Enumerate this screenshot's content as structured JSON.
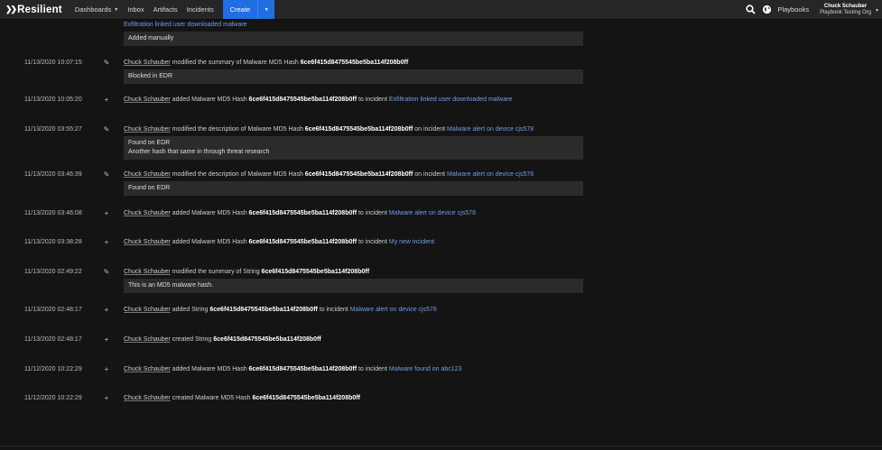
{
  "nav": {
    "logo": "Resilient",
    "items": [
      "Dashboards",
      "Inbox",
      "Artifacts",
      "Incidents"
    ],
    "create": "Create",
    "playbooks": "Playbooks",
    "user_name": "Chuck Schauber",
    "user_org": "Playbook Testing Org"
  },
  "top": {
    "partial_incident": "Exfiltration linked user downloaded malware",
    "note": "Added manually"
  },
  "entries": [
    {
      "ts": "11/13/2020 10:07:15",
      "icon": "pencil-icon",
      "user": "Chuck Schauber",
      "pre": "modified the summary of Malware MD5 Hash",
      "hash": "6ce6f415d8475545be5ba114f208b0ff",
      "mid": "",
      "incident": "",
      "note": [
        "Blocked in EDR"
      ]
    },
    {
      "ts": "11/13/2020 10:05:20",
      "icon": "plus-icon",
      "user": "Chuck Schauber",
      "pre": "added Malware MD5 Hash",
      "hash": "6ce6f415d8475545be5ba114f208b0ff",
      "mid": "to incident",
      "incident": "Exfiltration linked user downloaded malware",
      "note": []
    },
    {
      "ts": "11/13/2020 03:55:27",
      "icon": "pencil-icon",
      "user": "Chuck Schauber",
      "pre": "modified the description of Malware MD5 Hash",
      "hash": "6ce6f415d8475545be5ba114f208b0ff",
      "mid": "on incident",
      "incident": "Malware alert on device cjs578",
      "note": [
        "Found on EDR",
        "Another hash that same in through threat research"
      ]
    },
    {
      "ts": "11/13/2020 03:46:39",
      "icon": "pencil-icon",
      "user": "Chuck Schauber",
      "pre": "modified the description of Malware MD5 Hash",
      "hash": "6ce6f415d8475545be5ba114f208b0ff",
      "mid": "on incident",
      "incident": "Malware alert on device cjs578",
      "note": [
        "Found on EDR"
      ]
    },
    {
      "ts": "11/13/2020 03:46:08",
      "icon": "plus-icon",
      "user": "Chuck Schauber",
      "pre": "added Malware MD5 Hash",
      "hash": "6ce6f415d8475545be5ba114f208b0ff",
      "mid": "to incident",
      "incident": "Malware alert on device cjs578",
      "note": []
    },
    {
      "ts": "11/13/2020 03:38:28",
      "icon": "plus-icon",
      "user": "Chuck Schauber",
      "pre": "added Malware MD5 Hash",
      "hash": "6ce6f415d8475545be5ba114f208b0ff",
      "mid": "to incident",
      "incident": "My new incident",
      "note": []
    },
    {
      "ts": "11/13/2020 02:49:22",
      "icon": "pencil-icon",
      "user": "Chuck Schauber",
      "pre": "modified the summary of String",
      "hash": "6ce6f415d8475545be5ba114f208b0ff",
      "mid": "",
      "incident": "",
      "note": [
        "This is an MD5 malware hash."
      ]
    },
    {
      "ts": "11/13/2020 02:48:17",
      "icon": "plus-icon",
      "user": "Chuck Schauber",
      "pre": "added String",
      "hash": "6ce6f415d8475545be5ba114f208b0ff",
      "mid": "to incident",
      "incident": "Malware alert on device cjs578",
      "note": []
    },
    {
      "ts": "11/13/2020 02:48:17",
      "icon": "plus-icon",
      "user": "Chuck Schauber",
      "pre": "created String",
      "hash": "6ce6f415d8475545be5ba114f208b0ff",
      "mid": "",
      "incident": "",
      "note": []
    },
    {
      "ts": "11/12/2020 10:22:29",
      "icon": "plus-icon",
      "user": "Chuck Schauber",
      "pre": "added Malware MD5 Hash",
      "hash": "6ce6f415d8475545be5ba114f208b0ff",
      "mid": "to incident",
      "incident": "Malware found on abc123",
      "note": []
    },
    {
      "ts": "11/12/2020 10:22:29",
      "icon": "plus-icon",
      "user": "Chuck Schauber",
      "pre": "created Malware MD5 Hash",
      "hash": "6ce6f415d8475545be5ba114f208b0ff",
      "mid": "",
      "incident": "",
      "note": []
    }
  ]
}
